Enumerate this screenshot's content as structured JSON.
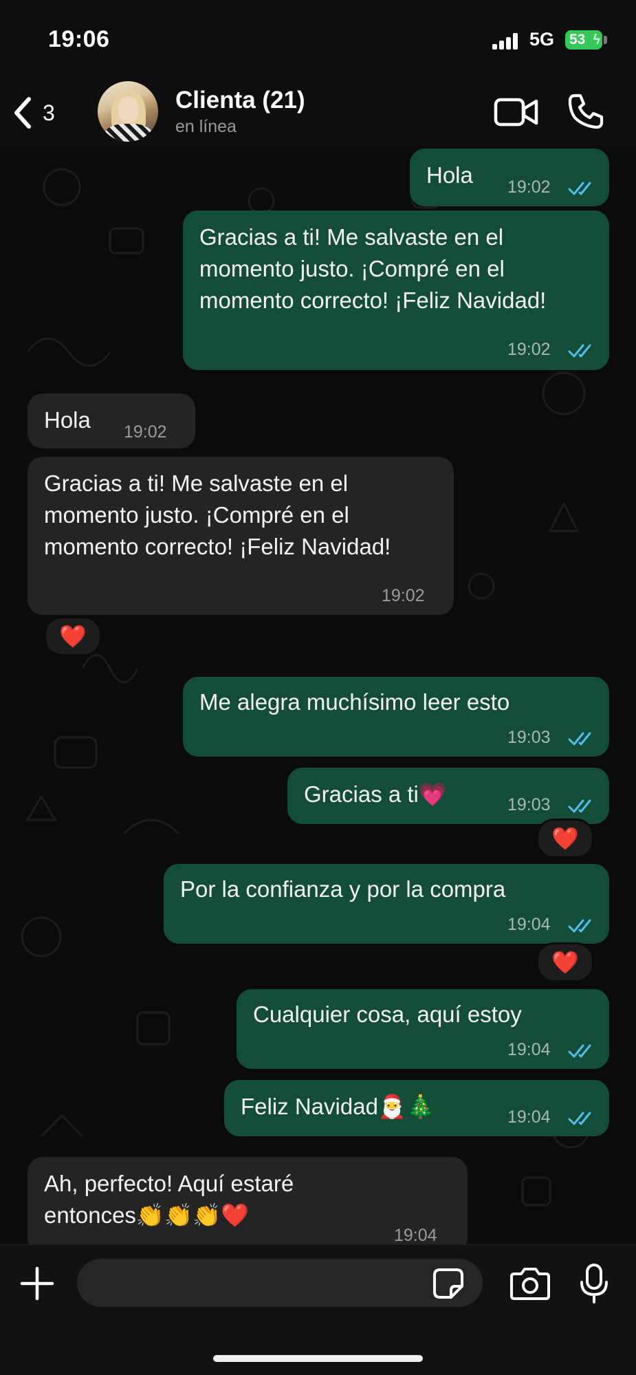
{
  "status_bar": {
    "time": "19:06",
    "network": "5G",
    "battery": "53"
  },
  "header": {
    "back_count": "3",
    "contact_name": "Clienta (21)",
    "contact_status": "en línea"
  },
  "messages": [
    {
      "direction": "out",
      "text": "Hola",
      "time": "19:02"
    },
    {
      "direction": "out",
      "text": "Gracias a ti! Me salvaste en el momento justo. ¡Compré en el momento correcto! ¡Feliz Navidad!",
      "time": "19:02"
    },
    {
      "direction": "in",
      "text": "Hola",
      "time": "19:02"
    },
    {
      "direction": "in",
      "text": "Gracias a ti! Me salvaste en el momento justo. ¡Compré en el momento correcto! ¡Feliz Navidad!",
      "time": "19:02",
      "reaction": "❤️"
    },
    {
      "direction": "out",
      "text": "Me alegra muchísimo leer esto",
      "time": "19:03"
    },
    {
      "direction": "out",
      "text": "Gracias a ti💗",
      "time": "19:03",
      "reaction": "❤️"
    },
    {
      "direction": "out",
      "text": "Por la confianza y por la compra",
      "time": "19:04",
      "reaction": "❤️"
    },
    {
      "direction": "out",
      "text": "Cualquier cosa, aquí estoy",
      "time": "19:04"
    },
    {
      "direction": "out",
      "text": "Feliz Navidad🎅🎄",
      "time": "19:04"
    },
    {
      "direction": "in",
      "text": "Ah, perfecto! Aquí estaré entonces👏👏👏❤️",
      "time": "19:04"
    }
  ],
  "input": {
    "placeholder": ""
  },
  "colors": {
    "outgoing_bubble": "#134d37",
    "incoming_bubble": "#242424",
    "read_ticks": "#53bdeb",
    "battery": "#34c759"
  },
  "icons": [
    "chevron-left-icon",
    "video-call-icon",
    "phone-icon",
    "plus-icon",
    "sticker-icon",
    "camera-icon",
    "microphone-icon",
    "double-check-icon"
  ]
}
